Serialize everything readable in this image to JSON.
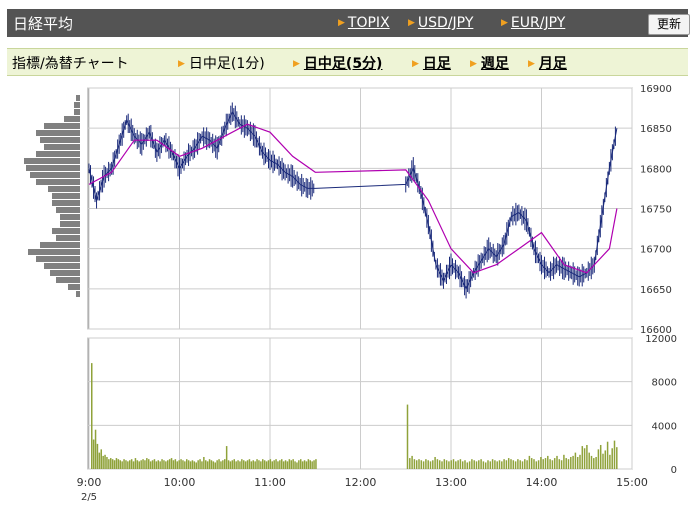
{
  "header": {
    "title": "日経平均",
    "nav": [
      {
        "label": "TOPIX"
      },
      {
        "label": "USD/JPY"
      },
      {
        "label": "EUR/JPY"
      }
    ],
    "refresh_label": "更新"
  },
  "tabs": {
    "indicator_label": "指標/為替チャート",
    "items": [
      {
        "label": "日中足(1分)",
        "active": true
      },
      {
        "label": "日中足(5分)",
        "active": false
      },
      {
        "label": "日足",
        "active": false
      },
      {
        "label": "週足",
        "active": false
      },
      {
        "label": "月足",
        "active": false
      }
    ]
  },
  "chart_data": [
    {
      "type": "line",
      "name": "price",
      "y_ticks": [
        "16900",
        "16850",
        "16800",
        "16750",
        "16700",
        "16650",
        "16600"
      ],
      "ylim": [
        16600,
        16900
      ],
      "x_ticks": [
        "9:00",
        "10:00",
        "11:00",
        "12:00",
        "13:00",
        "14:00",
        "15:00"
      ],
      "date_label": "2/5",
      "grid": true,
      "series": [
        {
          "values_time": [
            "9:00",
            "9:05",
            "9:10",
            "9:15",
            "9:20",
            "9:25",
            "9:30",
            "9:35",
            "9:40",
            "9:45",
            "9:50",
            "9:55",
            "10:00",
            "10:05",
            "10:10",
            "10:15",
            "10:20",
            "10:25",
            "10:30",
            "10:35",
            "10:40",
            "10:45",
            "10:50",
            "10:55",
            "11:00",
            "11:05",
            "11:10",
            "11:15",
            "11:20",
            "11:25",
            "11:30",
            "12:30",
            "12:35",
            "12:40",
            "12:45",
            "12:50",
            "12:55",
            "13:00",
            "13:05",
            "13:10",
            "13:15",
            "13:20",
            "13:25",
            "13:30",
            "13:35",
            "13:40",
            "13:45",
            "13:50",
            "13:55",
            "14:00",
            "14:05",
            "14:10",
            "14:15",
            "14:20",
            "14:25",
            "14:30",
            "14:35",
            "14:40",
            "14:45",
            "14:50"
          ],
          "values": [
            16800,
            16760,
            16790,
            16800,
            16830,
            16860,
            16840,
            16830,
            16845,
            16820,
            16835,
            16820,
            16800,
            16815,
            16825,
            16840,
            16835,
            16825,
            16850,
            16870,
            16855,
            16850,
            16840,
            16820,
            16810,
            16805,
            16795,
            16790,
            16780,
            16775,
            16775,
            16780,
            16800,
            16770,
            16730,
            16680,
            16660,
            16680,
            16670,
            16650,
            16670,
            16685,
            16700,
            16690,
            16705,
            16740,
            16745,
            16735,
            16700,
            16680,
            16670,
            16680,
            16675,
            16670,
            16665,
            16670,
            16680,
            16740,
            16800,
            16850
          ]
        },
        {
          "values_time": [
            "9:00",
            "9:15",
            "9:30",
            "9:45",
            "10:00",
            "10:15",
            "10:30",
            "10:45",
            "11:00",
            "11:15",
            "11:30",
            "12:30",
            "12:45",
            "13:00",
            "13:15",
            "13:30",
            "13:45",
            "14:00",
            "14:15",
            "14:30",
            "14:45",
            "14:50"
          ],
          "values": [
            16780,
            16795,
            16835,
            16835,
            16815,
            16825,
            16840,
            16855,
            16845,
            16815,
            16795,
            16798,
            16760,
            16700,
            16670,
            16680,
            16700,
            16720,
            16680,
            16670,
            16700,
            16750
          ]
        }
      ],
      "volume_profile": [
        2,
        3,
        3,
        8,
        18,
        22,
        20,
        18,
        22,
        28,
        27,
        25,
        22,
        16,
        14,
        14,
        12,
        10,
        10,
        14,
        12,
        20,
        26,
        22,
        18,
        15,
        12,
        6,
        2
      ]
    },
    {
      "type": "bar",
      "name": "volume",
      "y_ticks": [
        "12000",
        "8000",
        "4000",
        "0"
      ],
      "ylim": [
        0,
        12000
      ],
      "values_time_range": [
        "9:00",
        "15:00"
      ],
      "bars": [
        9700,
        2700,
        3600,
        2300,
        1500,
        1800,
        1200,
        1300,
        1100,
        900,
        1000,
        900,
        800,
        1000,
        900,
        800,
        700,
        900,
        800,
        700,
        800,
        900,
        700,
        1000,
        800,
        700,
        800,
        900,
        800,
        1000,
        900,
        700,
        800,
        900,
        700,
        800,
        700,
        900,
        800,
        700,
        800,
        900,
        1000,
        800,
        900,
        700,
        800,
        900,
        800,
        700,
        900,
        800,
        700,
        800,
        700,
        600,
        800,
        900,
        700,
        1100,
        800,
        700,
        900,
        800,
        700,
        600,
        800,
        900,
        700,
        800,
        900,
        2100,
        800,
        700,
        800,
        900,
        700,
        800,
        700,
        900,
        800,
        700,
        800,
        900,
        700,
        800,
        700,
        900,
        800,
        700,
        900,
        800,
        700,
        800,
        900,
        700,
        800,
        900,
        700,
        800,
        900,
        700,
        800,
        700,
        900,
        800,
        900,
        700,
        600,
        800,
        900,
        700,
        800,
        700,
        900,
        800,
        700,
        800,
        900,
        700,
        600
      ],
      "afternoon_bars": [
        5900,
        1000,
        1200,
        900,
        800,
        900,
        800,
        700,
        900,
        800,
        700,
        800,
        1100,
        900,
        800,
        700,
        900,
        800,
        700,
        800,
        900,
        700,
        800,
        900,
        700,
        800,
        600,
        700,
        900,
        800,
        700,
        800,
        900,
        700,
        600,
        800,
        700,
        900,
        800,
        700,
        800,
        700,
        900,
        800,
        1000,
        900,
        800,
        700,
        900,
        800,
        700,
        900,
        800,
        1200,
        1000,
        900,
        700,
        800,
        1100,
        900,
        1000,
        1200,
        900,
        800,
        1000,
        1200,
        900,
        800,
        1300,
        1000,
        900,
        1100,
        1200,
        1500,
        1100,
        1300,
        2100,
        1900,
        2200,
        1500,
        1200,
        1000,
        1100,
        1800,
        2200,
        1400,
        1700,
        2500,
        1300,
        1900,
        2600,
        2000,
        2300
      ]
    }
  ],
  "colors": {
    "price_line": "#1a2a7a",
    "moving_average": "#b000b0",
    "volume_bar": "#8fa23a",
    "profile_bar": "#808080",
    "grid": "#cccccc",
    "header_bg": "#545454",
    "tab_bg": "#eef4d6"
  }
}
